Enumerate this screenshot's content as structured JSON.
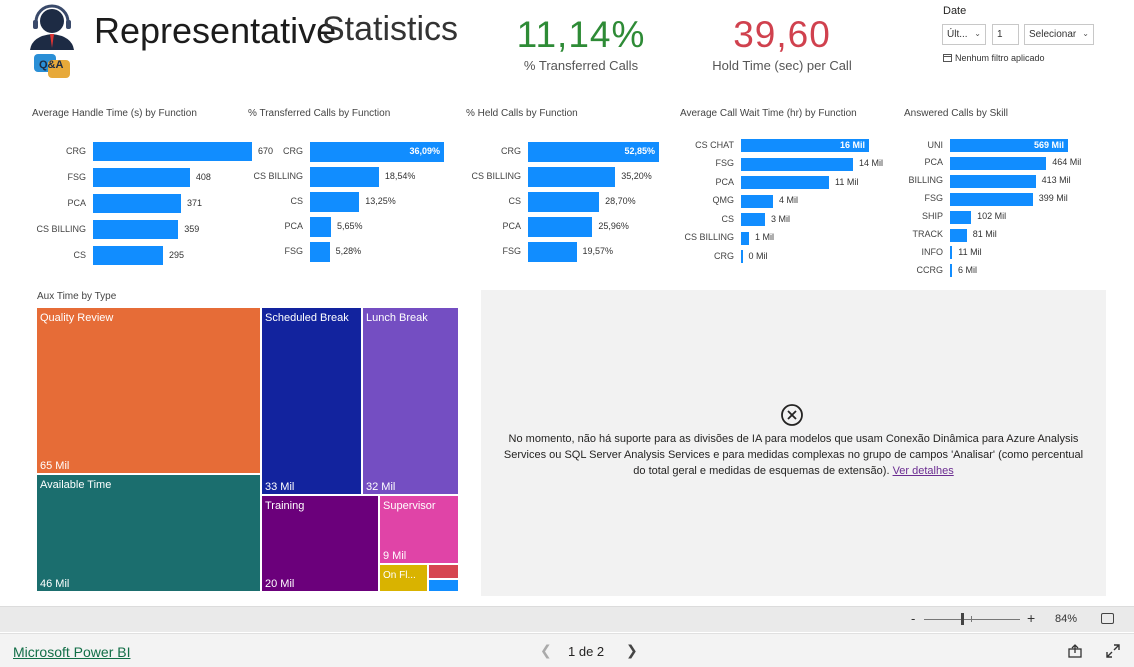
{
  "header": {
    "title_main": "Representative",
    "title_sub": "Statistics",
    "logo_text": "Q&A"
  },
  "kpis": [
    {
      "value": "11,14%",
      "label": "% Transferred Calls",
      "color": "#2e8b36"
    },
    {
      "value": "39,60",
      "label": "Hold Time (sec) per Call",
      "color": "#d0414e"
    }
  ],
  "slicer": {
    "title": "Date",
    "mode_value": "Últ...",
    "count_value": "1",
    "unit_value": "Selecionar",
    "no_filter": "Nenhum filtro aplicado"
  },
  "chart_data": [
    {
      "type": "bar",
      "title": "Average Handle Time (s) by Function",
      "categories": [
        "CRG",
        "FSG",
        "PCA",
        "CS BILLING",
        "CS"
      ],
      "values": [
        670,
        408,
        371,
        359,
        295
      ],
      "labels": [
        "670",
        "408",
        "371",
        "359",
        "295"
      ],
      "xlim": [
        0,
        670
      ]
    },
    {
      "type": "bar",
      "title": "% Transferred Calls by Function",
      "categories": [
        "CRG",
        "CS BILLING",
        "CS",
        "PCA",
        "FSG"
      ],
      "values": [
        36.09,
        18.54,
        13.25,
        5.65,
        5.28
      ],
      "labels": [
        "36,09%",
        "18,54%",
        "13,25%",
        "5,65%",
        "5,28%"
      ],
      "xlim": [
        0,
        36.09
      ]
    },
    {
      "type": "bar",
      "title": "% Held Calls by Function",
      "categories": [
        "CRG",
        "CS BILLING",
        "CS",
        "PCA",
        "FSG"
      ],
      "values": [
        52.85,
        35.2,
        28.7,
        25.96,
        19.57
      ],
      "labels": [
        "52,85%",
        "35,20%",
        "28,70%",
        "25,96%",
        "19,57%"
      ],
      "xlim": [
        0,
        52.85
      ]
    },
    {
      "type": "bar",
      "title": "Average Call Wait Time (hr) by Function",
      "categories": [
        "CS CHAT",
        "FSG",
        "PCA",
        "QMG",
        "CS",
        "CS BILLING",
        "CRG"
      ],
      "values": [
        16000,
        14000,
        11000,
        4000,
        3000,
        1000,
        0
      ],
      "labels": [
        "16 Mil",
        "14 Mil",
        "11 Mil",
        "4 Mil",
        "3 Mil",
        "1 Mil",
        "0 Mil"
      ],
      "xlim": [
        0,
        16000
      ]
    },
    {
      "type": "bar",
      "title": "Answered Calls by Skill",
      "categories": [
        "UNI",
        "PCA",
        "BILLING",
        "FSG",
        "SHIP",
        "TRACK",
        "INFO",
        "CCRG"
      ],
      "values": [
        569000,
        464000,
        413000,
        399000,
        102000,
        81000,
        11000,
        6000
      ],
      "labels": [
        "569 Mil",
        "464 Mil",
        "413 Mil",
        "399 Mil",
        "102 Mil",
        "81 Mil",
        "11 Mil",
        "6 Mil"
      ],
      "xlim": [
        0,
        569000
      ]
    }
  ],
  "treemap": {
    "title": "Aux Time by Type",
    "tiles": [
      {
        "name": "Quality Review",
        "value": "65 Mil",
        "color": "#e66c37"
      },
      {
        "name": "Available Time",
        "value": "46 Mil",
        "color": "#1b6e6e"
      },
      {
        "name": "Scheduled Break",
        "value": "33 Mil",
        "color": "#12239e"
      },
      {
        "name": "Lunch Break",
        "value": "32 Mil",
        "color": "#744ec2"
      },
      {
        "name": "Training",
        "value": "20 Mil",
        "color": "#6b007b"
      },
      {
        "name": "Supervisor",
        "value": "9 Mil",
        "color": "#e044a7"
      },
      {
        "name": "On Fl...",
        "value": "",
        "color": "#d9b300"
      },
      {
        "name": "",
        "value": "",
        "color": "#d64550"
      },
      {
        "name": "",
        "value": "",
        "color": "#118dff"
      }
    ]
  },
  "ai_panel": {
    "message": "No momento, não há suporte para as divisões de IA para modelos que usam Conexão Dinâmica para Azure Analysis Services ou SQL Server Analysis Services e para medidas complexas no grupo de campos 'Analisar' (como percentual do total geral e medidas de esquemas de extensão).",
    "link": "Ver detalhes"
  },
  "zoom": {
    "minus": "-",
    "plus": "+",
    "percent": "84%"
  },
  "footer": {
    "brand": "Microsoft Power BI",
    "page": "1 de 2"
  }
}
